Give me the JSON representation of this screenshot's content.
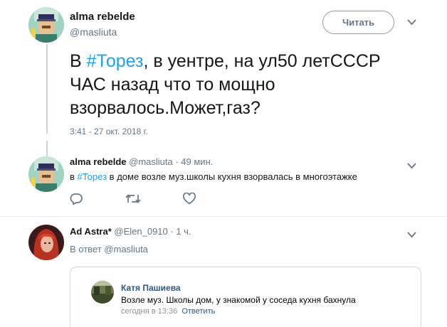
{
  "main_tweet": {
    "author_name": "alma rebelde",
    "author_handle": "@masliuta",
    "follow_label": "Читать",
    "text_prefix": "В ",
    "hashtag": "#Торез",
    "text_rest": ", в уентре, на ул50 летСССР ЧАС назад что то мощно взорвалось.Может,газ?",
    "timestamp": "3:41 - 27 окт. 2018 г."
  },
  "reply_tweet": {
    "author_name": "alma rebelde",
    "author_handle": "@masliuta",
    "time_ago": "· 49 мин.",
    "text_prefix": "в ",
    "hashtag": "#Торез",
    "text_rest": " в доме возле муз.школы кухня взорвалась в многоэтажке"
  },
  "third_tweet": {
    "author_name": "Ad Astra*",
    "author_handle": "@Elen_0910",
    "time_ago": "· 1 ч.",
    "in_reply_to": "В ответ @masliuta",
    "quote": {
      "name": "Катя Пашиева",
      "text": "Возле муз. Школы дом, у знакомой у соседа кухня бахнула",
      "date": "сегодня в 13:36",
      "reply_label": "Ответить"
    }
  },
  "icons": {
    "caret": "chevron-down-icon",
    "reply": "reply-icon",
    "retweet": "retweet-icon",
    "like": "heart-icon"
  },
  "colors": {
    "hashtag": "#1da1f2",
    "muted": "#657786",
    "vk_link": "#2a5885"
  }
}
